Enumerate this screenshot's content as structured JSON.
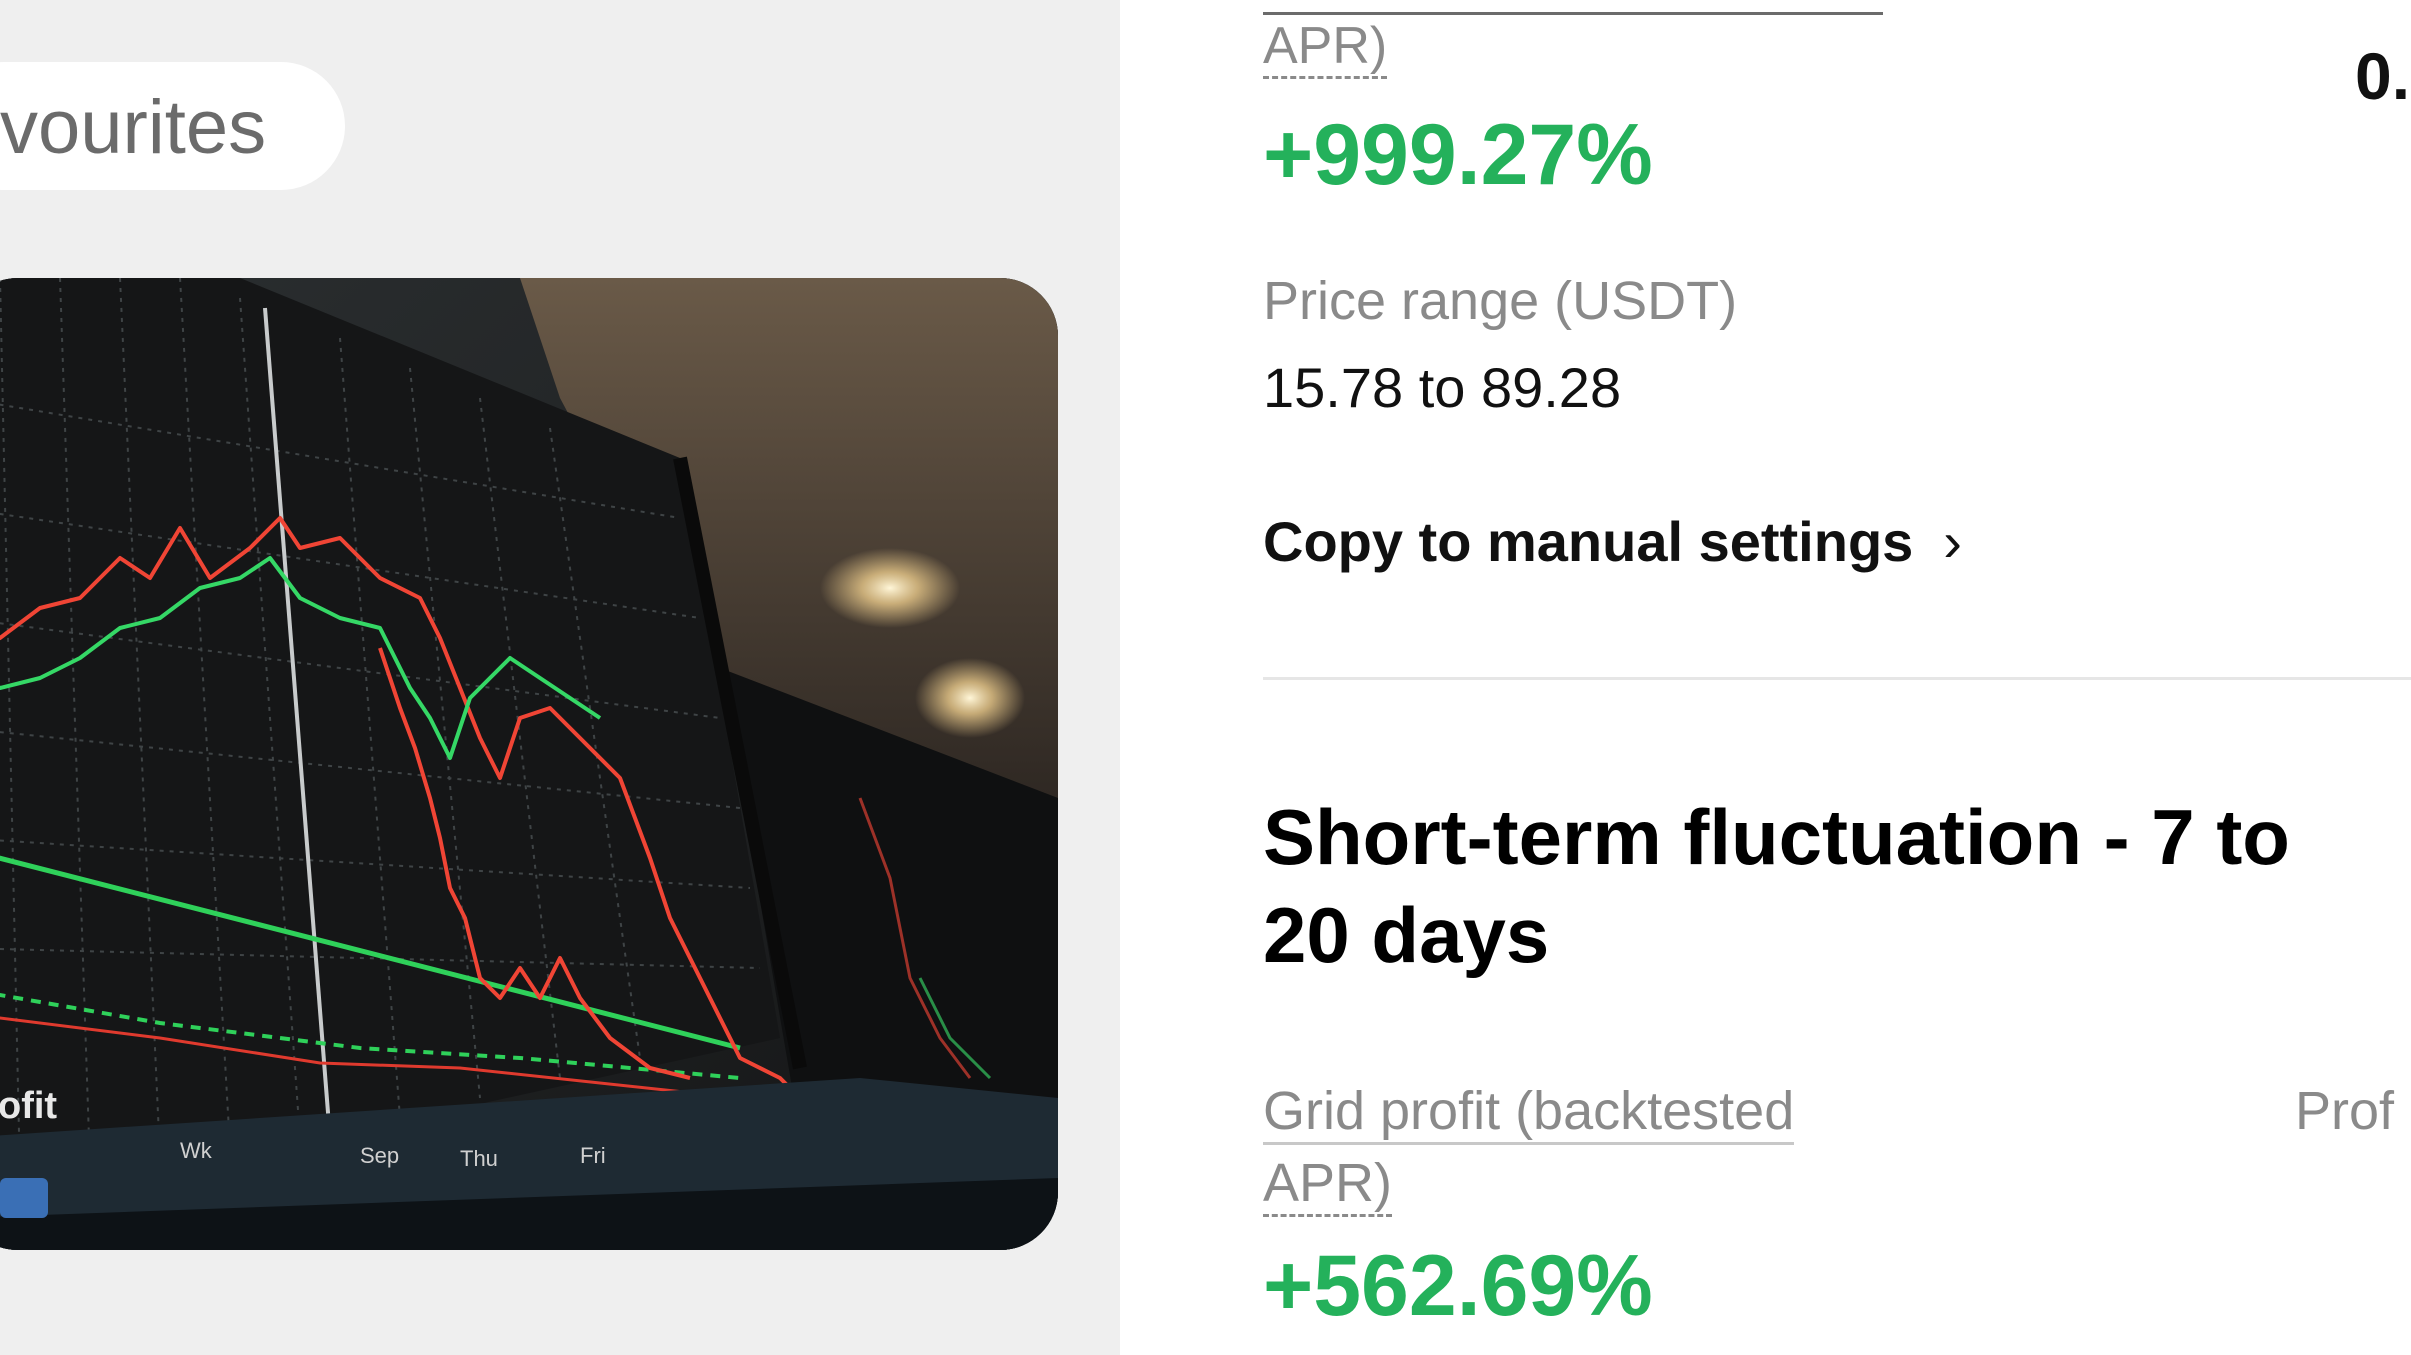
{
  "favourites": {
    "label": "vourites"
  },
  "top_section": {
    "apr_label_tail": "APR)",
    "apr_value": "+999.27%",
    "right_value_partial": "0.",
    "price_range_label": "Price range (USDT)",
    "price_range_value": "15.78 to 89.28",
    "copy_link": "Copy to manual settings",
    "copy_chevron": "›"
  },
  "short_term": {
    "title_line1": "Short-term fluctuation - 7 to",
    "title_line2": "20 days",
    "grid_profit_label_line1": "Grid profit (backtested",
    "grid_profit_label_line2": "APR)",
    "grid_profit_value": "+562.69%",
    "right_label_partial": "Prof"
  },
  "photo": {
    "overlay_text": "ofit",
    "axis_labels": [
      "Wk",
      "Sep",
      "Thu",
      "Fri"
    ]
  },
  "colors": {
    "accent_green": "#24b15b",
    "muted_text": "#8a8a8a",
    "left_bg": "#efefef"
  }
}
